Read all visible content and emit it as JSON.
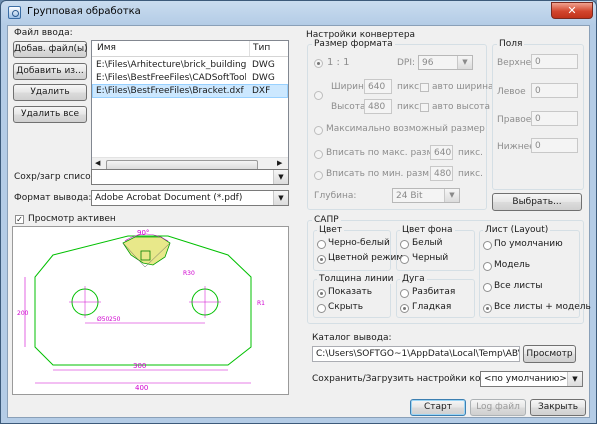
{
  "window": {
    "title": "Групповая обработка",
    "close": "✕"
  },
  "left": {
    "file_input_label": "Файл ввода:",
    "buttons": {
      "add_files": "Добав. файл(ы)",
      "add_from": "Добавить из...",
      "delete": "Удалить",
      "delete_all": "Удалить все"
    },
    "columns": {
      "name": "Имя",
      "type": "Тип"
    },
    "files": [
      {
        "name": "E:\\Files\\Arhitecture\\brick_building\\bui...",
        "type": "DWG"
      },
      {
        "name": "E:\\Files\\BestFreeFiles\\CADSoftTools.d...",
        "type": "DWG"
      },
      {
        "name": "E:\\Files\\BestFreeFiles\\Bracket.dxf",
        "type": "DXF"
      }
    ],
    "save_load_label": "Сохр/загр список:",
    "save_load_value": "",
    "output_format_label": "Формат вывода:",
    "output_format_value": "Adobe Acrobat Document (*.pdf)",
    "preview_label": "Просмотр активен",
    "preview_checked": true,
    "preview_drawing": {
      "angle": "90°",
      "dim_250": "250",
      "dim_300": "300",
      "dim_400": "400",
      "dim_200": "200",
      "dim_r50": "Ø50",
      "dim_r30": "R30",
      "dim_r1": "R1"
    }
  },
  "converter": {
    "title": "Настройки конвертера",
    "size_format": {
      "title": "Размер формата",
      "ratio_label": "1 : 1",
      "dpi_label": "DPI:",
      "dpi_value": "96",
      "width_label": "Ширина",
      "width_value": "640",
      "height_label": "Высота",
      "height_value": "480",
      "unit": "пикс.",
      "auto_width": "авто ширина",
      "auto_height": "авто высота",
      "max_size": "Максимально возможный размер",
      "fit_max": "Вписать по макс. разм.",
      "fit_max_value": "640",
      "fit_min": "Вписать по мин. разм.",
      "fit_min_value": "480",
      "depth_label": "Глубина:",
      "depth_value": "24 Bit"
    },
    "margins": {
      "title": "Поля",
      "top_label": "Верхнее",
      "top_value": "0",
      "left_label": "Левое",
      "left_value": "0",
      "right_label": "Правое",
      "right_value": "0",
      "bottom_label": "Нижнее",
      "bottom_value": "0"
    },
    "select_button": "Выбрать...",
    "cad": {
      "title": "САПР",
      "color_title": "Цвет",
      "color_bw": "Черно-белый",
      "color_color": "Цветной режим",
      "bg_title": "Цвет фона",
      "bg_white": "Белый",
      "bg_black": "Черный",
      "layout_title": "Лист (Layout)",
      "layout_default": "По умолчанию",
      "layout_model": "Модель",
      "layout_all": "Все листы",
      "layout_all_model": "Все листы + модель",
      "lineweight_title": "Толщина линии",
      "lw_show": "Показать",
      "lw_hide": "Скрыть",
      "arc_title": "Дуга",
      "arc_split": "Разбитая",
      "arc_smooth": "Гладкая"
    },
    "output_dir_label": "Каталог вывода:",
    "output_dir_value": "C:\\Users\\SOFTGO~1\\AppData\\Local\\Temp\\ABViewer",
    "browse_button": "Просмотр",
    "save_load_settings_label": "Сохранить/Загрузить настройки конвертера:",
    "save_load_settings_value": "<по умолчанию>"
  },
  "footer": {
    "start": "Старт",
    "log": "Log файл",
    "close": "Закрыть"
  }
}
